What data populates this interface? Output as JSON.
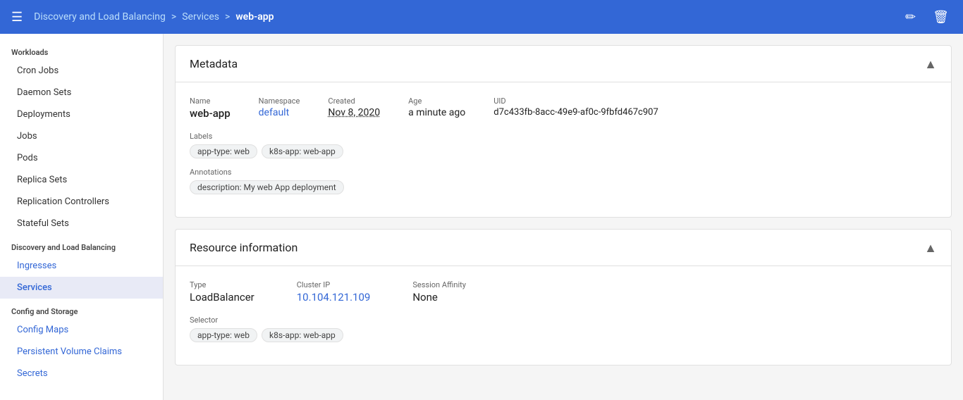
{
  "header": {
    "menu_icon": "☰",
    "breadcrumb": {
      "link1": "Discovery and Load Balancing",
      "sep1": ">",
      "link2": "Services",
      "sep2": ">",
      "current": "web-app"
    },
    "edit_icon": "✏",
    "delete_icon": "🗑"
  },
  "sidebar": {
    "section_workloads": "Workloads",
    "items_workloads": [
      {
        "label": "Cron Jobs",
        "id": "cron-jobs",
        "active": false
      },
      {
        "label": "Daemon Sets",
        "id": "daemon-sets",
        "active": false
      },
      {
        "label": "Deployments",
        "id": "deployments",
        "active": false
      },
      {
        "label": "Jobs",
        "id": "jobs",
        "active": false
      },
      {
        "label": "Pods",
        "id": "pods",
        "active": false
      },
      {
        "label": "Replica Sets",
        "id": "replica-sets",
        "active": false
      },
      {
        "label": "Replication Controllers",
        "id": "replication-controllers",
        "active": false
      },
      {
        "label": "Stateful Sets",
        "id": "stateful-sets",
        "active": false
      }
    ],
    "section_discovery": "Discovery and Load Balancing",
    "items_discovery": [
      {
        "label": "Ingresses",
        "id": "ingresses",
        "active": false
      },
      {
        "label": "Services",
        "id": "services",
        "active": true
      }
    ],
    "section_config": "Config and Storage",
    "items_config": [
      {
        "label": "Config Maps",
        "id": "config-maps",
        "active": false
      },
      {
        "label": "Persistent Volume Claims",
        "id": "pvc",
        "active": false
      },
      {
        "label": "Secrets",
        "id": "secrets",
        "active": false
      }
    ]
  },
  "metadata_card": {
    "title": "Metadata",
    "name_label": "Name",
    "name_value": "web-app",
    "namespace_label": "Namespace",
    "namespace_value": "default",
    "created_label": "Created",
    "created_value": "Nov 8, 2020",
    "age_label": "Age",
    "age_value": "a minute ago",
    "uid_label": "UID",
    "uid_value": "d7c433fb-8acc-49e9-af0c-9fbfd467c907",
    "labels_label": "Labels",
    "labels": [
      {
        "text": "app-type: web"
      },
      {
        "text": "k8s-app: web-app"
      }
    ],
    "annotations_label": "Annotations",
    "annotations": [
      {
        "text": "description: My web App deployment"
      }
    ],
    "collapse_icon": "▲"
  },
  "resource_card": {
    "title": "Resource information",
    "type_label": "Type",
    "type_value": "LoadBalancer",
    "cluster_ip_label": "Cluster IP",
    "cluster_ip_value": "10.104.121.109",
    "session_affinity_label": "Session Affinity",
    "session_affinity_value": "None",
    "selector_label": "Selector",
    "selectors": [
      {
        "text": "app-type: web"
      },
      {
        "text": "k8s-app: web-app"
      }
    ],
    "collapse_icon": "▲"
  }
}
